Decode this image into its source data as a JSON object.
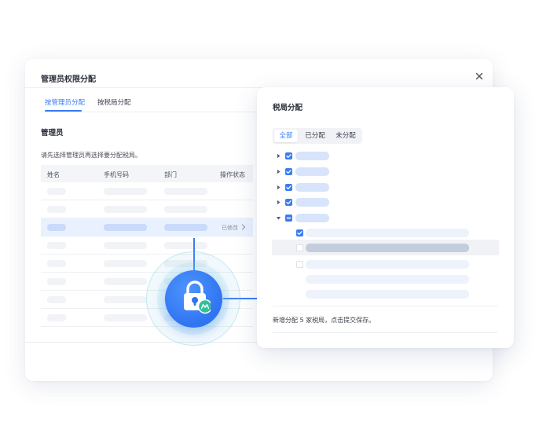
{
  "dialog": {
    "title": "管理员权限分配",
    "tabs": [
      {
        "label": "按管理员分配",
        "active": true
      },
      {
        "label": "按税局分配",
        "active": false
      }
    ],
    "section_title": "管理员",
    "hint": "请先选择管理员再选择要分配税局。",
    "table": {
      "columns": [
        "姓名",
        "手机号码",
        "部门",
        "操作状态"
      ],
      "selected_row_status": "已修改"
    }
  },
  "panel": {
    "title": "税局分配",
    "filter": {
      "options": [
        "全部",
        "已分配",
        "未分配"
      ],
      "selected": "全部"
    },
    "footer": "新增分配 5 家税局，点击提交保存。"
  },
  "colors": {
    "accent": "#3a7cf5",
    "badge_green": "#2fc29a"
  },
  "icons": [
    "close-icon",
    "chevron-right-icon",
    "caret-right-icon",
    "caret-down-icon",
    "check-icon",
    "lock-icon"
  ]
}
